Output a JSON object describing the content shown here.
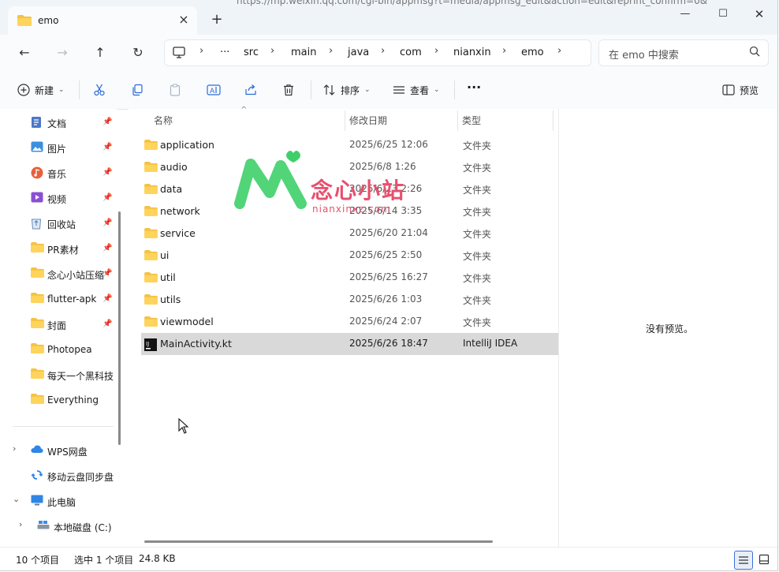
{
  "window": {
    "tab_title": "emo",
    "background_url": "https://mp.weixin.qq.com/cgi-bin/appmsg?t=media/appmsg_edit&action=edit&reprint_confirm=0&"
  },
  "address": {
    "crumbs": [
      "src",
      "main",
      "java",
      "com",
      "nianxin",
      "emo"
    ],
    "more": "···"
  },
  "search": {
    "placeholder": "在 emo 中搜索"
  },
  "toolbar": {
    "new_label": "新建",
    "sort_label": "排序",
    "view_label": "查看",
    "more_label": "···",
    "preview_label": "预览"
  },
  "sidebar": {
    "items": [
      {
        "label": "文档",
        "icon": "documents-icon",
        "pinned": true
      },
      {
        "label": "图片",
        "icon": "pictures-icon",
        "pinned": true
      },
      {
        "label": "音乐",
        "icon": "music-icon",
        "pinned": true
      },
      {
        "label": "视频",
        "icon": "videos-icon",
        "pinned": true
      },
      {
        "label": "回收站",
        "icon": "recycle-bin-icon",
        "pinned": true
      },
      {
        "label": "PR素材",
        "icon": "folder-icon",
        "pinned": true
      },
      {
        "label": "念心小站压缩",
        "icon": "folder-icon",
        "pinned": true
      },
      {
        "label": "flutter-apk",
        "icon": "folder-icon",
        "pinned": true
      },
      {
        "label": "封面",
        "icon": "folder-icon",
        "pinned": true
      },
      {
        "label": "Photopea",
        "icon": "folder-icon",
        "pinned": false
      },
      {
        "label": "每天一个黑科技",
        "icon": "folder-icon",
        "pinned": false
      },
      {
        "label": "Everything",
        "icon": "folder-icon",
        "pinned": false
      }
    ],
    "drives": [
      {
        "label": "WPS网盘",
        "icon": "cloud-icon"
      },
      {
        "label": "移动云盘同步盘",
        "icon": "cloud-sync-icon"
      },
      {
        "label": "此电脑",
        "icon": "this-pc-icon"
      },
      {
        "label": "本地磁盘 (C:)",
        "icon": "drive-icon"
      }
    ]
  },
  "columns": {
    "name": "名称",
    "date": "修改日期",
    "type": "类型"
  },
  "files": [
    {
      "name": "application",
      "date": "2025/6/25 12:06",
      "type": "文件夹",
      "kind": "folder"
    },
    {
      "name": "audio",
      "date": "2025/6/8 1:26",
      "type": "文件夹",
      "kind": "folder"
    },
    {
      "name": "data",
      "date": "2025/6/23 2:26",
      "type": "文件夹",
      "kind": "folder"
    },
    {
      "name": "network",
      "date": "2025/6/14 3:35",
      "type": "文件夹",
      "kind": "folder"
    },
    {
      "name": "service",
      "date": "2025/6/20 21:04",
      "type": "文件夹",
      "kind": "folder"
    },
    {
      "name": "ui",
      "date": "2025/6/25 2:50",
      "type": "文件夹",
      "kind": "folder"
    },
    {
      "name": "util",
      "date": "2025/6/25 16:27",
      "type": "文件夹",
      "kind": "folder"
    },
    {
      "name": "utils",
      "date": "2025/6/26 1:03",
      "type": "文件夹",
      "kind": "folder"
    },
    {
      "name": "viewmodel",
      "date": "2025/6/24 2:07",
      "type": "文件夹",
      "kind": "folder"
    },
    {
      "name": "MainActivity.kt",
      "date": "2025/6/26 18:47",
      "type": "IntelliJ IDEA",
      "kind": "kotlin",
      "selected": true
    }
  ],
  "watermark": {
    "text": "念心小站",
    "sub": "nianxinxz.com"
  },
  "preview": {
    "empty_text": "没有预览。"
  },
  "status": {
    "count": "10 个项目",
    "selected": "选中 1 个项目",
    "size": "24.8 KB"
  },
  "colors": {
    "folder": "#f5c242",
    "accent": "#3b6fd4",
    "watermark": "#e8506e",
    "logo_green": "#3fcf6a"
  }
}
